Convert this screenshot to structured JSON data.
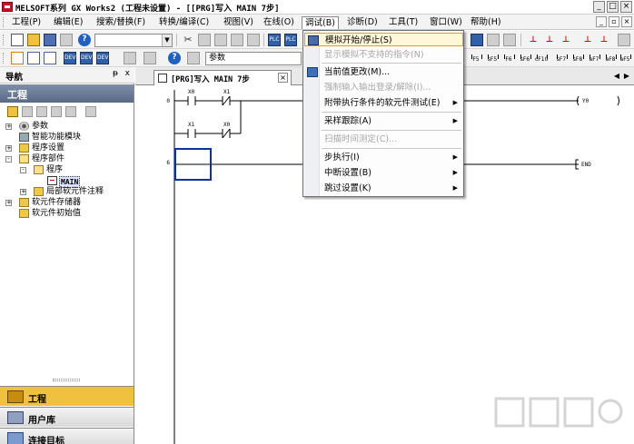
{
  "window": {
    "title": "MELSOFT系列 GX Works2 (工程未设置) - [[PRG]写入 MAIN 7步]",
    "buttons": [
      "_",
      "□",
      "×"
    ]
  },
  "menubar": {
    "items": [
      "工程(P)",
      "编辑(E)",
      "搜索/替换(F)",
      "转换/编译(C)",
      "视图(V)",
      "在线(O)",
      "调试(B)",
      "诊断(D)",
      "工具(T)",
      "窗口(W)",
      "帮助(H)"
    ],
    "active": "调试(B)"
  },
  "toolbar": {
    "combo_value": "",
    "param_label": "参数"
  },
  "navigation": {
    "title": "导航",
    "pin": "ᵽ",
    "close": "x",
    "project_header": "工程",
    "tree": [
      {
        "label": "参数",
        "icon": "gear-icon",
        "expander": "+"
      },
      {
        "label": "智能功能模块",
        "icon": "module-icon",
        "expander": ""
      },
      {
        "label": "程序设置",
        "icon": "folder-icon",
        "expander": "+"
      },
      {
        "label": "程序部件",
        "icon": "folder-open-icon",
        "expander": "-"
      },
      {
        "label": "程序",
        "icon": "folder-open-icon",
        "expander": "-"
      },
      {
        "label": "MAIN",
        "icon": "program-icon",
        "expander": ""
      },
      {
        "label": "局部软元件注释",
        "icon": "folder-icon",
        "expander": "+"
      },
      {
        "label": "软元件存储器",
        "icon": "folder-icon",
        "expander": "+"
      },
      {
        "label": "软元件初始值",
        "icon": "folder-icon",
        "expander": ""
      }
    ],
    "bottom_buttons": [
      "工程",
      "用户库",
      "连接目标"
    ]
  },
  "editor": {
    "tab_label": "[PRG]写入 MAIN 7步",
    "tab_close": "×",
    "tab_prev": "◀",
    "tab_next": "▶",
    "step_numbers": [
      "0",
      "6"
    ],
    "contacts": [
      "X0",
      "X1",
      "X1",
      "X0"
    ],
    "coils": [
      "Y0",
      "END"
    ]
  },
  "debug_menu": {
    "items": [
      {
        "label": "模拟开始/停止(S)",
        "state": "highlighted",
        "submenu": false
      },
      {
        "label": "显示模拟不支持的指令(N)",
        "state": "disabled",
        "submenu": false
      },
      {
        "label": "当前值更改(M)...",
        "state": "normal",
        "submenu": false
      },
      {
        "label": "强制输入输出登录/解除(I)...",
        "state": "disabled",
        "submenu": false
      },
      {
        "label": "附带执行条件的软元件测试(E)",
        "state": "normal",
        "submenu": true
      },
      {
        "label": "采样跟踪(A)",
        "state": "normal",
        "submenu": true
      },
      {
        "label": "扫描时间测定(C)...",
        "state": "disabled",
        "submenu": false
      },
      {
        "label": "步执行(I)",
        "state": "normal",
        "submenu": true
      },
      {
        "label": "中断设置(B)",
        "state": "normal",
        "submenu": true
      },
      {
        "label": "跳过设置(K)",
        "state": "normal",
        "submenu": true
      }
    ]
  },
  "colors": {
    "accent": "#f0c040",
    "menu_highlight": "#fff7d8",
    "project_header": "#6b7b96"
  }
}
